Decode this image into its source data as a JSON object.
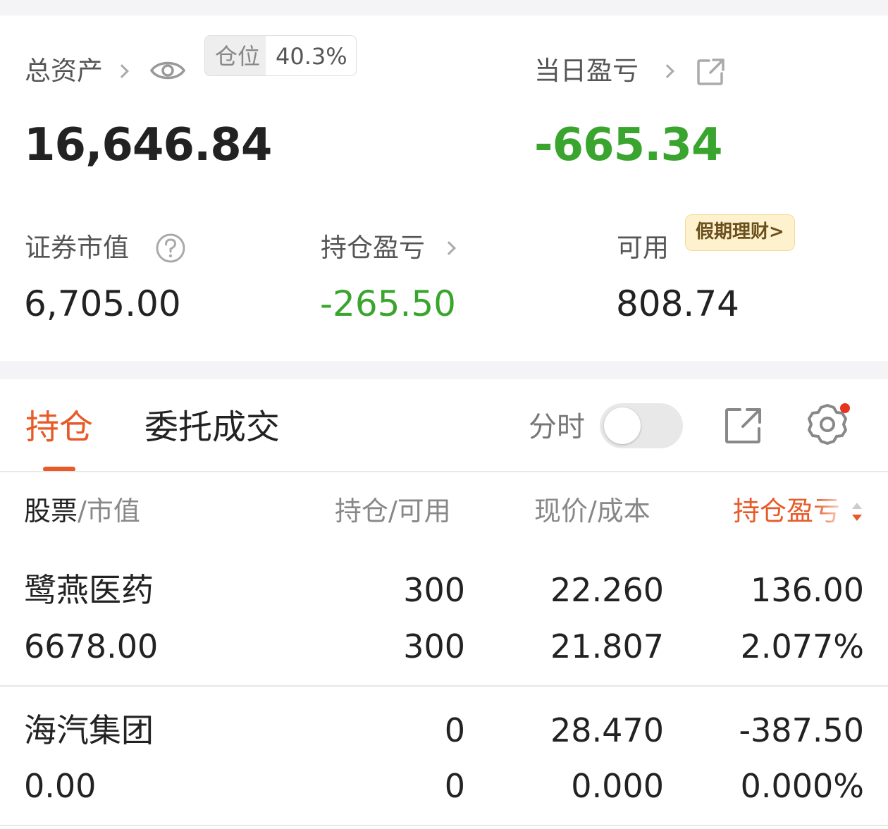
{
  "summary": {
    "total_assets_label": "总资产",
    "position_label": "仓位",
    "position_value": "40.3%",
    "total_assets_value": "16,646.84",
    "daily_pnl_label": "当日盈亏",
    "daily_pnl_value": "-665.34",
    "securities_value_label": "证券市值",
    "securities_value": "6,705.00",
    "holding_pnl_label": "持仓盈亏",
    "holding_pnl_value": "-265.50",
    "available_label": "可用",
    "available_value": "808.74",
    "holiday_badge": "假期理财>"
  },
  "tabs": {
    "holdings": "持仓",
    "orders": "委托成交",
    "timeshare_label": "分时",
    "timeshare_on": false
  },
  "table": {
    "headers": {
      "stock": "股票",
      "market_value": "/市值",
      "holding_available": "持仓/可用",
      "price_cost": "现价/成本",
      "holding_pnl": "持仓盈亏"
    },
    "rows": [
      {
        "name": "鹭燕医药",
        "market_value": "6678.00",
        "holding": "300",
        "available": "300",
        "price": "22.260",
        "cost": "21.807",
        "pnl": "136.00",
        "pnl_pct": "2.077%"
      },
      {
        "name": "海汽集团",
        "market_value": "0.00",
        "holding": "0",
        "available": "0",
        "price": "28.470",
        "cost": "0.000",
        "pnl": "-387.50",
        "pnl_pct": "0.000%"
      }
    ]
  },
  "colors": {
    "profit": "#d93a30",
    "loss": "#3aa52e",
    "accent": "#e85a28",
    "notification_dot": "#e8341c"
  },
  "icons": [
    "eye-icon",
    "external-link-icon",
    "help-icon",
    "share-icon",
    "settings-icon"
  ]
}
